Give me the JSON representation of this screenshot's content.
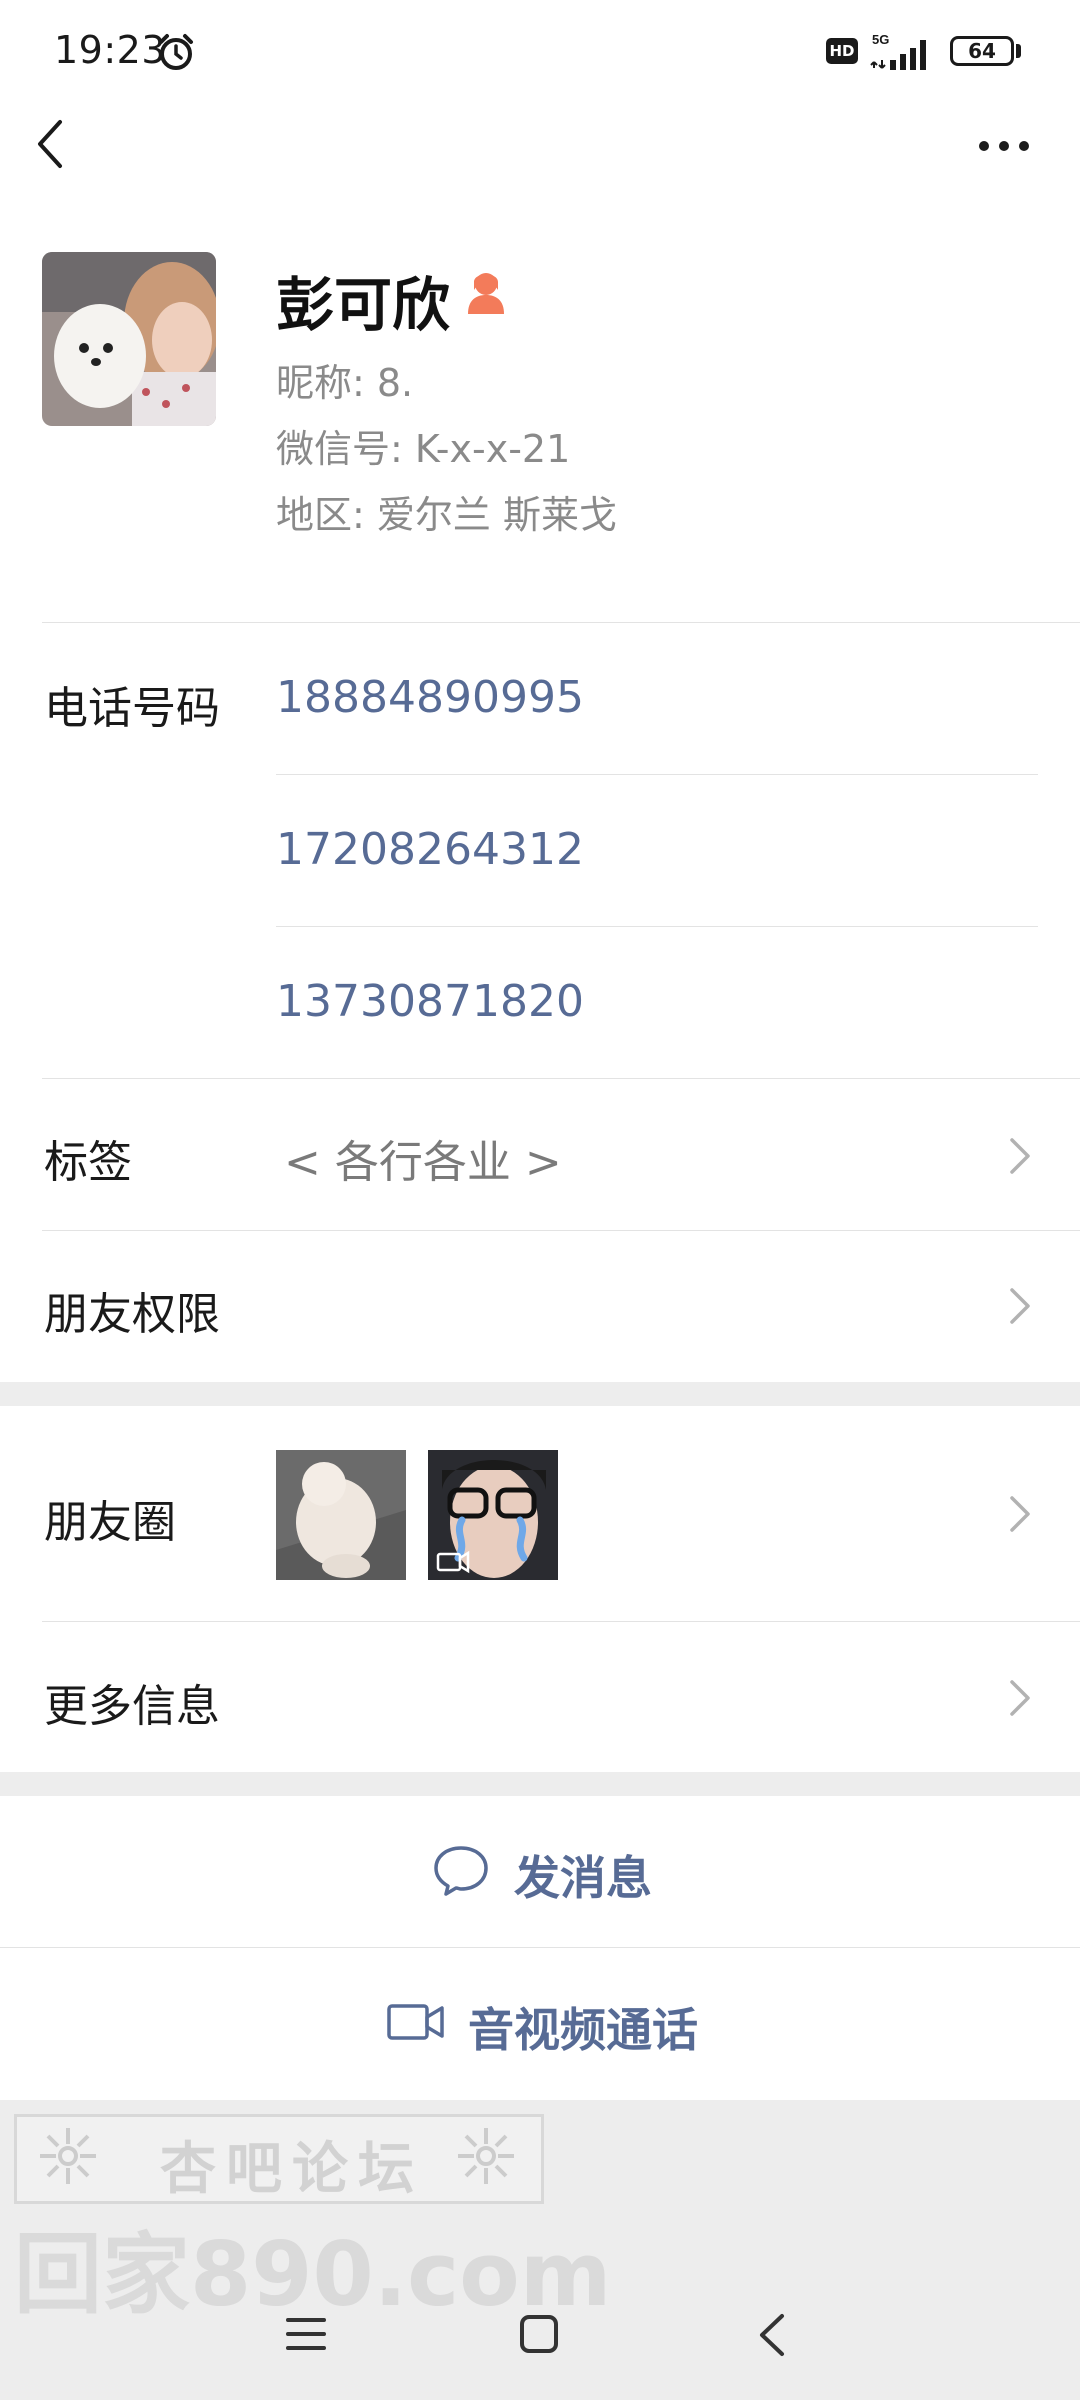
{
  "status_bar": {
    "time": "19:23",
    "hd": "HD",
    "network": "5G",
    "battery": "64",
    "battery_level": 0.64
  },
  "profile": {
    "name": "彭可欣",
    "nickname": "昵称: 8.",
    "wechat_id": "微信号: K-x-x-21",
    "region": "地区: 爱尔兰  斯莱戈"
  },
  "phone_section": {
    "label": "电话号码",
    "numbers": [
      "18884890995",
      "17208264312",
      "13730871820"
    ]
  },
  "tags": {
    "label": "标签",
    "value": "< 各行各业 >"
  },
  "permissions": {
    "label": "朋友权限"
  },
  "moments": {
    "label": "朋友圈"
  },
  "more_info": {
    "label": "更多信息"
  },
  "actions": {
    "message": "发消息",
    "video_call": "音视频通话"
  },
  "watermark": {
    "forum": "杏吧论坛",
    "site": "回家890.com"
  },
  "colors": {
    "link_blue": "#576b95",
    "background": "#ededed",
    "card": "#ffffff",
    "gender_female": "#f37b5a"
  }
}
